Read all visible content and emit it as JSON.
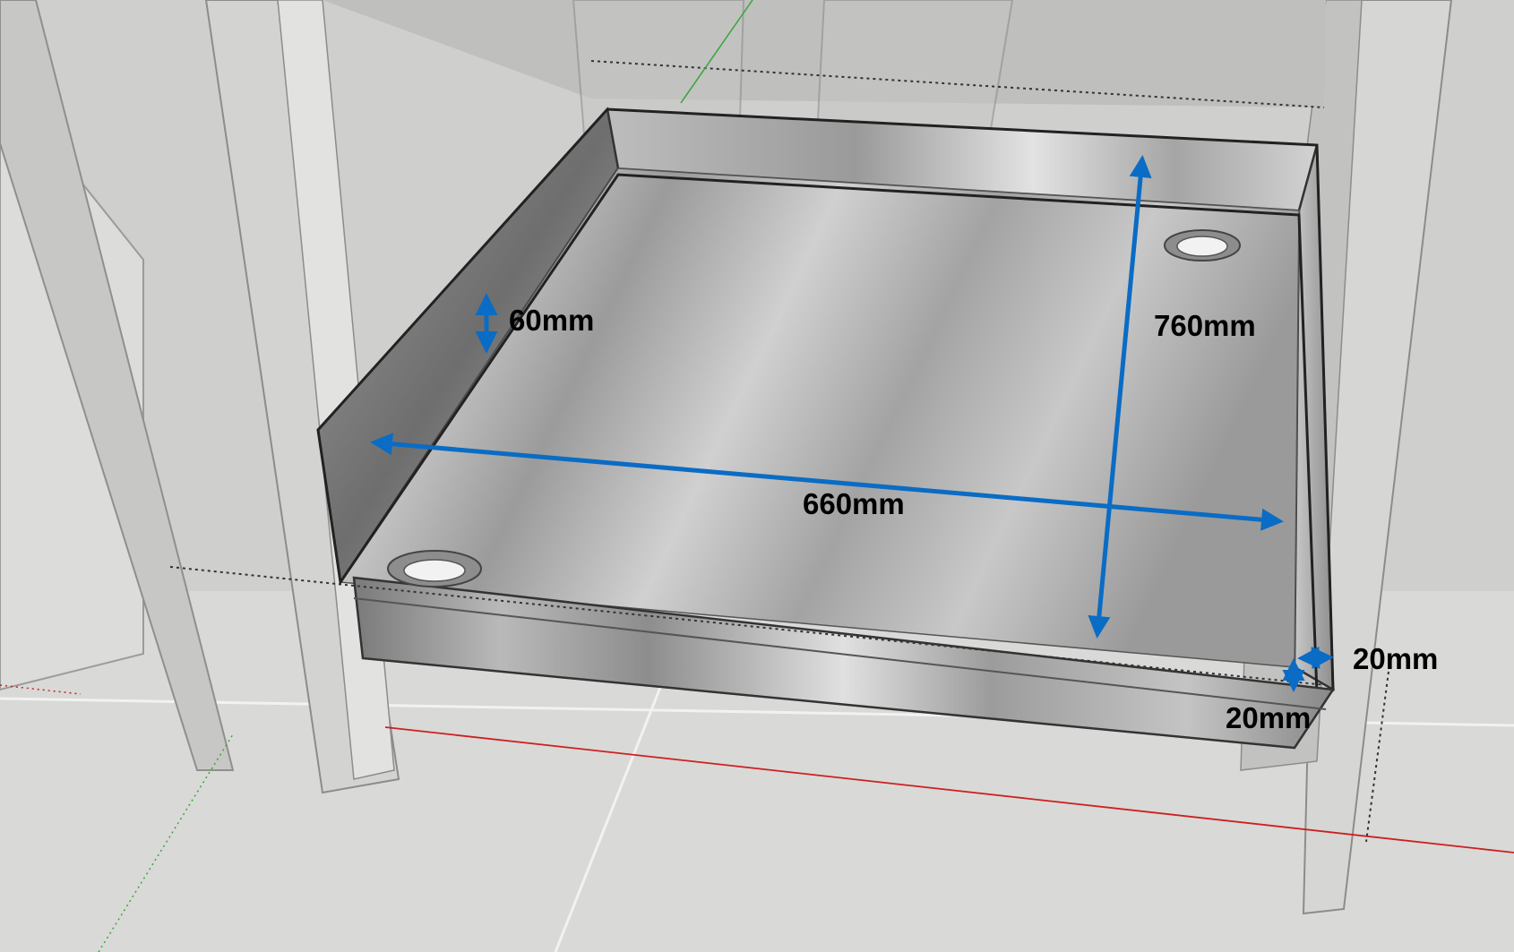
{
  "dimensions": {
    "side_height": "60mm",
    "depth": "760mm",
    "width": "660mm",
    "side_thickness": "20mm",
    "base_thickness": "20mm"
  },
  "colors": {
    "dimension_arrows": "#0a6cc4",
    "tray_steel_light": "#d6d6d6",
    "tray_steel_dark": "#7d7d7d",
    "floor": "#d8d8d6",
    "wall": "#cbcbc9",
    "axis_red": "#cc2020",
    "axis_green": "#3aa53a"
  }
}
